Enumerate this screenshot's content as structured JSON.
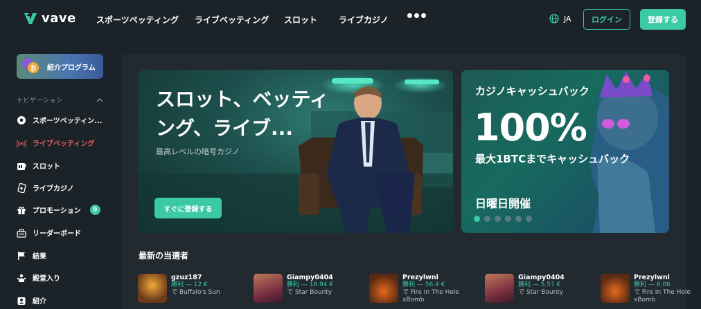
{
  "header": {
    "logo_text": "vave",
    "nav": [
      "スポーツベッティング",
      "ライブベッティング",
      "スロット",
      "ライブカジノ"
    ],
    "more_icon": "more-dots-icon",
    "language": "JA",
    "login_label": "ログイン",
    "register_label": "登録する"
  },
  "sidebar": {
    "promo_label": "紹介プログラム",
    "nav_header": "ナビゲーション",
    "items": [
      {
        "label": "スポーツベッティン...",
        "icon": "soccer-ball-icon",
        "active": false
      },
      {
        "label": "ライブベッティング",
        "icon": "live-signal-icon",
        "active": true
      },
      {
        "label": "スロット",
        "icon": "slot-machine-icon",
        "active": false
      },
      {
        "label": "ライブカジノ",
        "icon": "casino-card-icon",
        "active": false
      },
      {
        "label": "プロモーション",
        "icon": "gift-icon",
        "active": false,
        "badge": "9"
      },
      {
        "label": "リーダーボード",
        "icon": "leaderboard-icon",
        "active": false
      },
      {
        "label": "結果",
        "icon": "flag-icon",
        "active": false
      },
      {
        "label": "殿堂入り",
        "icon": "hall-of-fame-icon",
        "active": false
      },
      {
        "label": "紹介",
        "icon": "referral-icon",
        "active": false
      }
    ]
  },
  "banner_main": {
    "title": "スロット、ベッティング、ライブ...",
    "subtitle": "最高レベルの暗号カジノ",
    "cta": "すぐに登録する"
  },
  "banner_side": {
    "title": "カジノキャッシュバック",
    "big": "100%",
    "subtitle": "最大1BTCまでキャッシュバック",
    "day": "日曜日開催",
    "dots_total": 6,
    "dots_active": 0
  },
  "winners": {
    "title": "最新の当選者",
    "list": [
      {
        "name": "gzuz187",
        "win": "勝利 — 12 €",
        "game": "で Buffalo's Sun",
        "thumb_color": "#6a3a1a"
      },
      {
        "name": "Giampy0404",
        "win": "勝利 — 16.94 €",
        "game": "で Star Bounty",
        "thumb_color": "#7a3040"
      },
      {
        "name": "Prezylwnl",
        "win": "勝利 — 56.4 €",
        "game": "で Fire In The Hole xBomb",
        "thumb_color": "#5a2a12"
      },
      {
        "name": "Giampy0404",
        "win": "勝利 — 5.57 €",
        "game": "で Star Bounty",
        "thumb_color": "#7a3040"
      },
      {
        "name": "Prezylwnl",
        "win": "勝利 — 6.06",
        "game": "で Fire In The Hole xBomb",
        "thumb_color": "#5a2a12"
      }
    ]
  }
}
